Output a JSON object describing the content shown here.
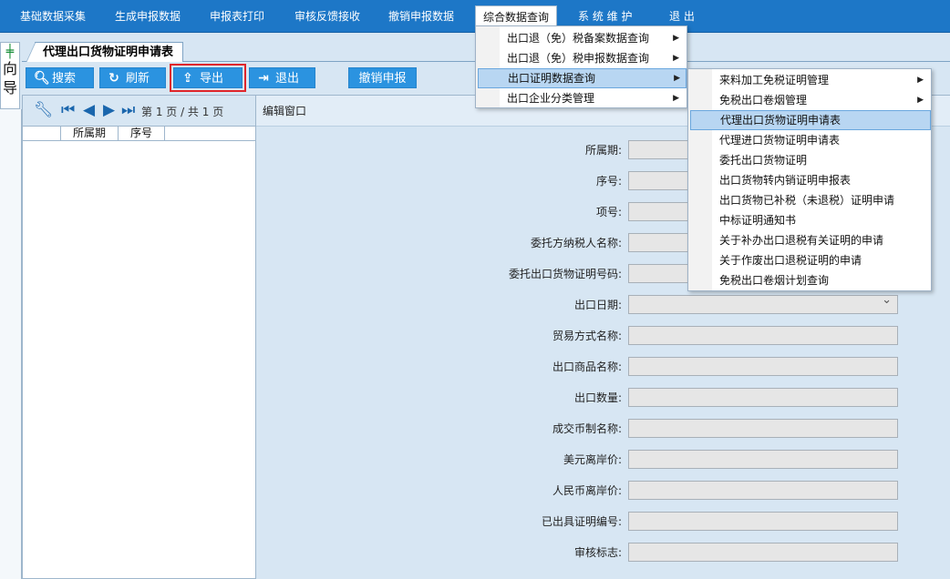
{
  "menubar": {
    "items": [
      "基础数据采集",
      "生成申报数据",
      "申报表打印",
      "审核反馈接收",
      "撤销申报数据",
      "综合数据查询",
      "系 统 维 护",
      "退  出"
    ]
  },
  "guide": {
    "text": "向导"
  },
  "tab": {
    "title": "代理出口货物证明申请表"
  },
  "toolbar": {
    "search": "搜索",
    "refresh": "刷新",
    "export": "导出",
    "exit": "退出",
    "revoke": "撤销申报"
  },
  "list": {
    "pager_text": "第 1 页 / 共 1 页",
    "columns": [
      "所属期",
      "序号"
    ]
  },
  "edit": {
    "header": "编辑窗口",
    "fields": [
      "所属期:",
      "序号:",
      "项号:",
      "委托方纳税人名称:",
      "委托出口货物证明号码:",
      "出口日期:",
      "贸易方式名称:",
      "出口商品名称:",
      "出口数量:",
      "成交币制名称:",
      "美元离岸价:",
      "人民币离岸价:",
      "已出具证明编号:",
      "审核标志:"
    ]
  },
  "menu1": {
    "items": [
      "出口退（免）税备案数据查询",
      "出口退（免）税申报数据查询",
      "出口证明数据查询",
      "出口企业分类管理"
    ],
    "selected_index": 2
  },
  "menu2": {
    "items": [
      "来料加工免税证明管理",
      "免税出口卷烟管理",
      "代理出口货物证明申请表",
      "代理进口货物证明申请表",
      "委托出口货物证明",
      "出口货物转内销证明申报表",
      "出口货物已补税（未退税）证明申请",
      "中标证明通知书",
      "关于补办出口退税有关证明的申请",
      "关于作废出口退税证明的申请",
      "免税出口卷烟计划查询"
    ],
    "selected_index": 2
  },
  "colors": {
    "menubar": "#1d77c7",
    "button": "#2b93e0",
    "panel_bg": "#d7e6f3",
    "highlight_outline": "#e0262b",
    "menu_selected": "#b8d6f2"
  }
}
